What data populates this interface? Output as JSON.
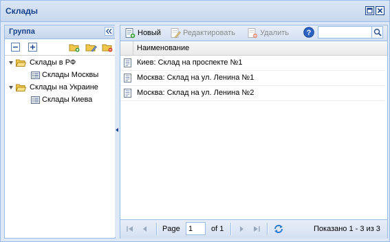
{
  "window": {
    "title": "Склады"
  },
  "left_panel": {
    "title": "Группа",
    "tree": [
      {
        "label": "Склады в РФ",
        "type": "folder",
        "level": 0
      },
      {
        "label": "Склады Москвы",
        "type": "leaf",
        "level": 1
      },
      {
        "label": "Склады на Украине",
        "type": "folder",
        "level": 0
      },
      {
        "label": "Склады Киева",
        "type": "leaf",
        "level": 1
      }
    ]
  },
  "toolbar": {
    "new_label": "Новый",
    "edit_label": "Редактировать",
    "delete_label": "Удалить",
    "search_value": ""
  },
  "grid": {
    "column_header": "Наименование",
    "rows": [
      "Киев: Склад на проспекте №1",
      "Москва: Склад на ул. Ленина №1",
      "Москва: Склад на ул. Ленина №2"
    ]
  },
  "pager": {
    "page_label": "Page",
    "page_value": "1",
    "of_label": "of 1",
    "summary": "Показано 1 - 3 из 3"
  },
  "colors": {
    "border": "#99bbe8",
    "title_text": "#15428b",
    "panel_bg": "#dfe8f6",
    "folder": "#f1c84b"
  }
}
